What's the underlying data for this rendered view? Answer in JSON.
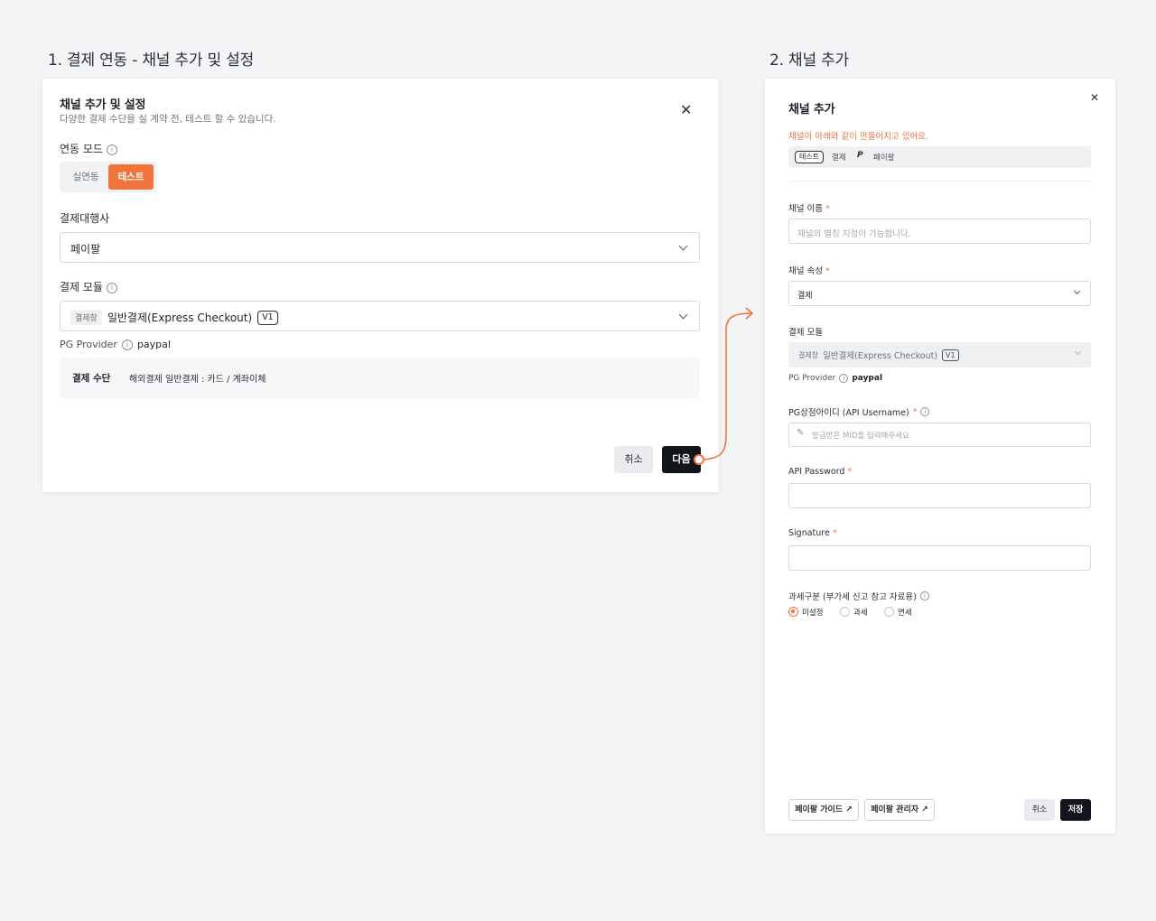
{
  "steps": {
    "step1_title": "1. 결제 연동 - 채널 추가 및 설정",
    "step2_title": "2. 채널 추가"
  },
  "dialog1": {
    "title": "채널 추가 및 설정",
    "subtitle": "다양한 결제 수단을 실 계약 전, 테스트 할 수 있습니다.",
    "mode_label": "연동 모드",
    "mode_options": [
      "실연동",
      "테스트"
    ],
    "mode_selected": "테스트",
    "pg_label": "결제대행사",
    "pg_value": "페이팔",
    "module_label": "결제 모듈",
    "module_tag": "결제창",
    "module_value": "일반결제(Express Checkout)",
    "module_version": "V1",
    "provider_label": "PG Provider",
    "provider_value": "paypal",
    "method_label": "결제 수단",
    "method_value": "해외결제 일반결제 : 카드 / 계좌이체",
    "cancel_label": "취소",
    "next_label": "다음"
  },
  "dialog2": {
    "title": "채널 추가",
    "notice": "채널이 아래와 같이 만들어지고 있어요.",
    "preview": {
      "mode_tag": "테스트",
      "type": "결제",
      "pg_name": "페이팔"
    },
    "name_label": "채널 이름",
    "name_placeholder": "채널의 별칭 지정이 가능합니다.",
    "attr_label": "채널 속성",
    "attr_value": "결제",
    "module_label": "결제 모듈",
    "module_tag": "결제창",
    "module_value": "일반결제(Express Checkout)",
    "module_version": "V1",
    "provider_label": "PG Provider",
    "provider_value": "paypal",
    "mid_label": "PG상점아이디 (API Username)",
    "mid_placeholder": "발급받은 MID를 입력해주세요",
    "password_label": "API Password",
    "signature_label": "Signature",
    "tax_label": "과세구분 (부가세 신고 참고 자료용)",
    "tax_options": [
      "미설정",
      "과세",
      "면세"
    ],
    "tax_selected": "미설정",
    "guide_button": "페이팔 가이드 ↗",
    "admin_button": "페이팔 관리자 ↗",
    "cancel_label": "취소",
    "save_label": "저장"
  },
  "colors": {
    "accent": "#f2733b",
    "dark": "#12161c"
  }
}
